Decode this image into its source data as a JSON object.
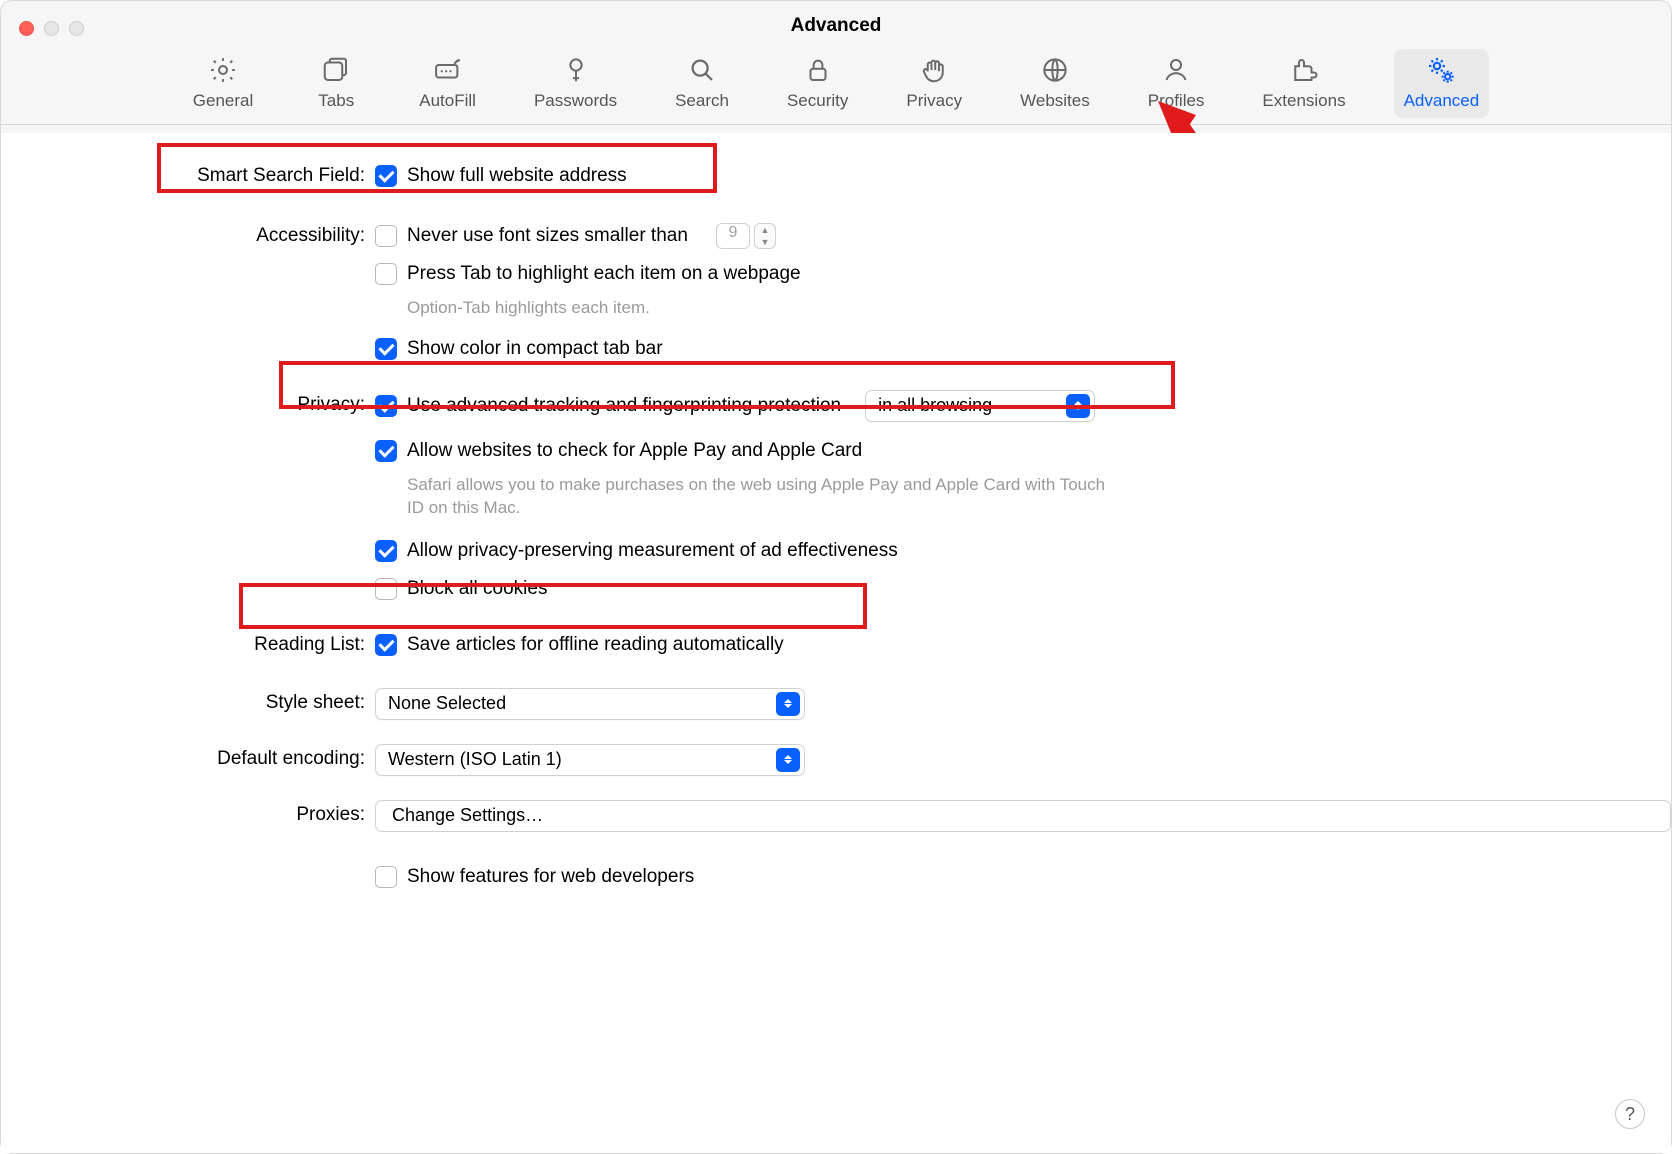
{
  "window": {
    "title": "Advanced"
  },
  "toolbar": {
    "items": [
      {
        "id": "general",
        "label": "General"
      },
      {
        "id": "tabs",
        "label": "Tabs"
      },
      {
        "id": "autofill",
        "label": "AutoFill"
      },
      {
        "id": "passwords",
        "label": "Passwords"
      },
      {
        "id": "search",
        "label": "Search"
      },
      {
        "id": "security",
        "label": "Security"
      },
      {
        "id": "privacy",
        "label": "Privacy"
      },
      {
        "id": "websites",
        "label": "Websites"
      },
      {
        "id": "profiles",
        "label": "Profiles"
      },
      {
        "id": "extensions",
        "label": "Extensions"
      },
      {
        "id": "advanced",
        "label": "Advanced",
        "active": true
      }
    ]
  },
  "sections": {
    "smart_search": {
      "label": "Smart Search Field:",
      "show_full_address": {
        "checked": true,
        "label": "Show full website address"
      }
    },
    "accessibility": {
      "label": "Accessibility:",
      "min_font": {
        "checked": false,
        "label": "Never use font sizes smaller than",
        "value": "9"
      },
      "press_tab": {
        "checked": false,
        "label": "Press Tab to highlight each item on a webpage"
      },
      "press_tab_help": "Option-Tab highlights each item.",
      "compact_color": {
        "checked": true,
        "label": "Show color in compact tab bar"
      }
    },
    "privacy": {
      "label": "Privacy:",
      "adv_tracking": {
        "checked": true,
        "label": "Use advanced tracking and fingerprinting protection",
        "mode": "in all browsing"
      },
      "apple_pay": {
        "checked": true,
        "label": "Allow websites to check for Apple Pay and Apple Card"
      },
      "apple_pay_help": "Safari allows you to make purchases on the web using Apple Pay and Apple Card with Touch ID on this Mac.",
      "ad_measure": {
        "checked": true,
        "label": "Allow privacy-preserving measurement of ad effectiveness"
      },
      "block_cookies": {
        "checked": false,
        "label": "Block all cookies"
      }
    },
    "reading_list": {
      "label": "Reading List:",
      "save_offline": {
        "checked": true,
        "label": "Save articles for offline reading automatically"
      }
    },
    "style_sheet": {
      "label": "Style sheet:",
      "value": "None Selected"
    },
    "default_encoding": {
      "label": "Default encoding:",
      "value": "Western (ISO Latin 1)"
    },
    "proxies": {
      "label": "Proxies:",
      "button": "Change Settings…"
    },
    "dev": {
      "checked": false,
      "label": "Show features for web developers"
    }
  },
  "help_button": "?"
}
